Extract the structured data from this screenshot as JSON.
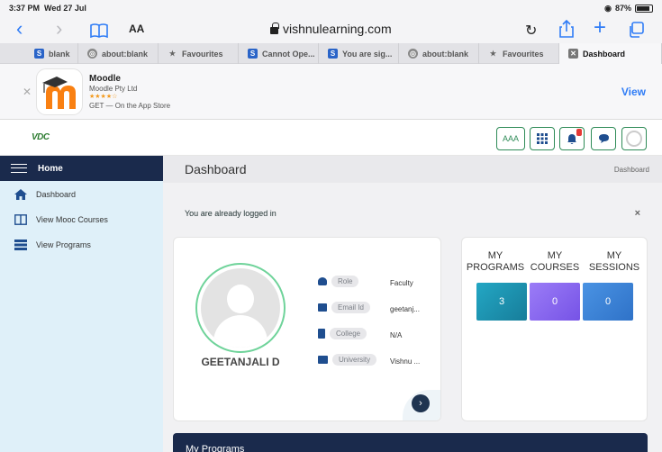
{
  "status": {
    "time": "3:37 PM",
    "date": "Wed 27 Jul",
    "battery": "87%"
  },
  "browser": {
    "aa_label": "AA",
    "url": "vishnulearning.com",
    "tabs": [
      {
        "label": "blank",
        "icon": "s-blue"
      },
      {
        "label": "about:blank",
        "icon": "compass"
      },
      {
        "label": "Favourites",
        "icon": "star"
      },
      {
        "label": "Cannot Ope...",
        "icon": "s-blue"
      },
      {
        "label": "You are sig...",
        "icon": "s-blue"
      },
      {
        "label": "about:blank",
        "icon": "compass"
      },
      {
        "label": "Favourites",
        "icon": "star"
      },
      {
        "label": "Dashboard",
        "icon": "x-box",
        "active": true
      }
    ]
  },
  "banner": {
    "app_name": "Moodle",
    "developer": "Moodle Pty Ltd",
    "stars": "★★★★☆",
    "get_text": "GET — On the App Store",
    "view_label": "View"
  },
  "header": {
    "logo": "VDC",
    "font_button": "AAA"
  },
  "sidebar": {
    "home_label": "Home",
    "items": [
      {
        "label": "Dashboard",
        "icon": "home-icon"
      },
      {
        "label": "View Mooc Courses",
        "icon": "book-icon"
      },
      {
        "label": "View Programs",
        "icon": "programs-icon"
      }
    ]
  },
  "main": {
    "page_title": "Dashboard",
    "breadcrumb": "Dashboard",
    "alert_text": "You are already logged in",
    "alert_close": "×",
    "profile": {
      "name": "GEETANJALI D",
      "rows": [
        {
          "label": "Role",
          "value": "Faculty"
        },
        {
          "label": "Email Id",
          "value": "geetanj..."
        },
        {
          "label": "College",
          "value": "N/A"
        },
        {
          "label": "University",
          "value": "Vishnu ..."
        }
      ]
    },
    "stats": [
      {
        "label": "MY PROGRAMS",
        "value": "3",
        "color": "#1f97b1"
      },
      {
        "label": "MY COURSES",
        "value": "0",
        "color": "#8b6df0"
      },
      {
        "label": "MY SESSIONS",
        "value": "0",
        "color": "#3b86d9"
      }
    ],
    "programs_title": "My Programs"
  },
  "colors": {
    "accent": "#1a2a4c",
    "safari_blue": "#2f7cf6",
    "sidebar_bg": "#dff0f9"
  }
}
